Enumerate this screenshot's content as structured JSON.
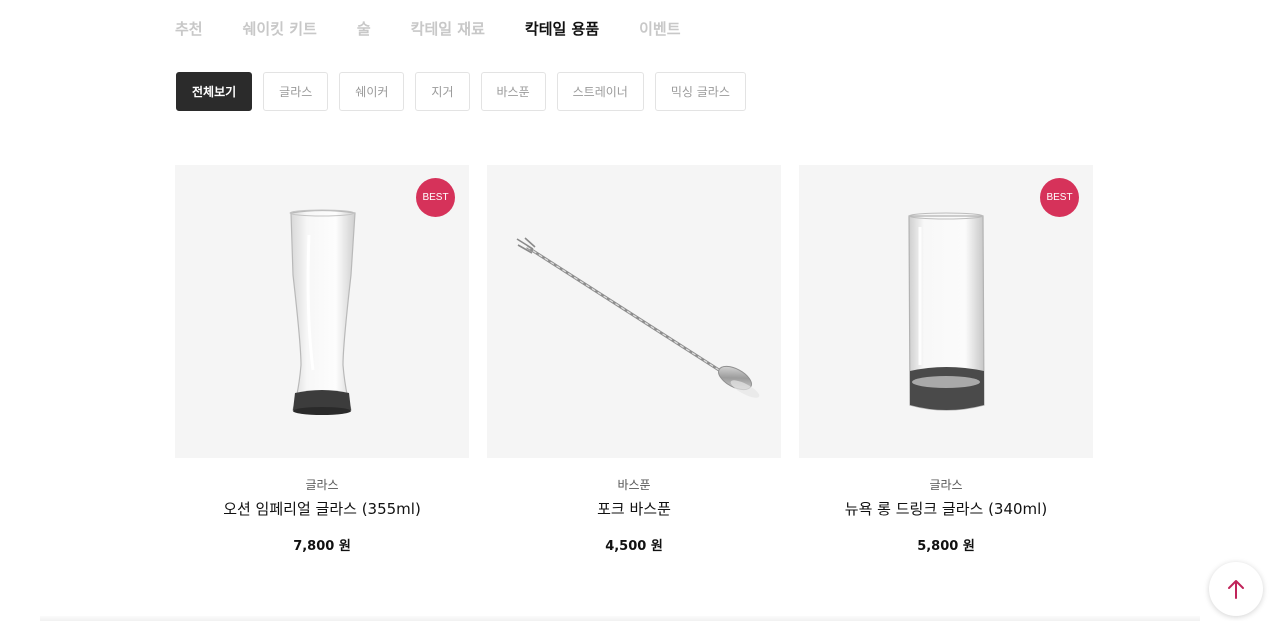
{
  "main_nav": [
    {
      "label": "추천",
      "active": false
    },
    {
      "label": "쉐이킷 키트",
      "active": false
    },
    {
      "label": "술",
      "active": false
    },
    {
      "label": "칵테일 재료",
      "active": false
    },
    {
      "label": "칵테일 용품",
      "active": true
    },
    {
      "label": "이벤트",
      "active": false
    }
  ],
  "filters": [
    {
      "label": "전체보기",
      "active": true
    },
    {
      "label": "글라스",
      "active": false
    },
    {
      "label": "쉐이커",
      "active": false
    },
    {
      "label": "지거",
      "active": false
    },
    {
      "label": "바스푼",
      "active": false
    },
    {
      "label": "스트레이너",
      "active": false
    },
    {
      "label": "믹싱 글라스",
      "active": false
    }
  ],
  "products": [
    {
      "category": "글라스",
      "name": "오션 임페리얼 글라스 (355ml)",
      "price": "7,800 원",
      "badge": "BEST",
      "image": "pilsner-glass"
    },
    {
      "category": "바스푼",
      "name": "포크 바스푼",
      "price": "4,500 원",
      "badge": "",
      "image": "bar-spoon"
    },
    {
      "category": "글라스",
      "name": "뉴욕 롱 드링크 글라스 (340ml)",
      "price": "5,800 원",
      "badge": "BEST",
      "image": "highball-glass"
    }
  ],
  "scroll_top": {
    "icon": "arrow-up-icon"
  },
  "colors": {
    "accent": "#d6325a",
    "active_filter_bg": "#2b2b2b",
    "inactive_text": "#c8c8c8"
  }
}
